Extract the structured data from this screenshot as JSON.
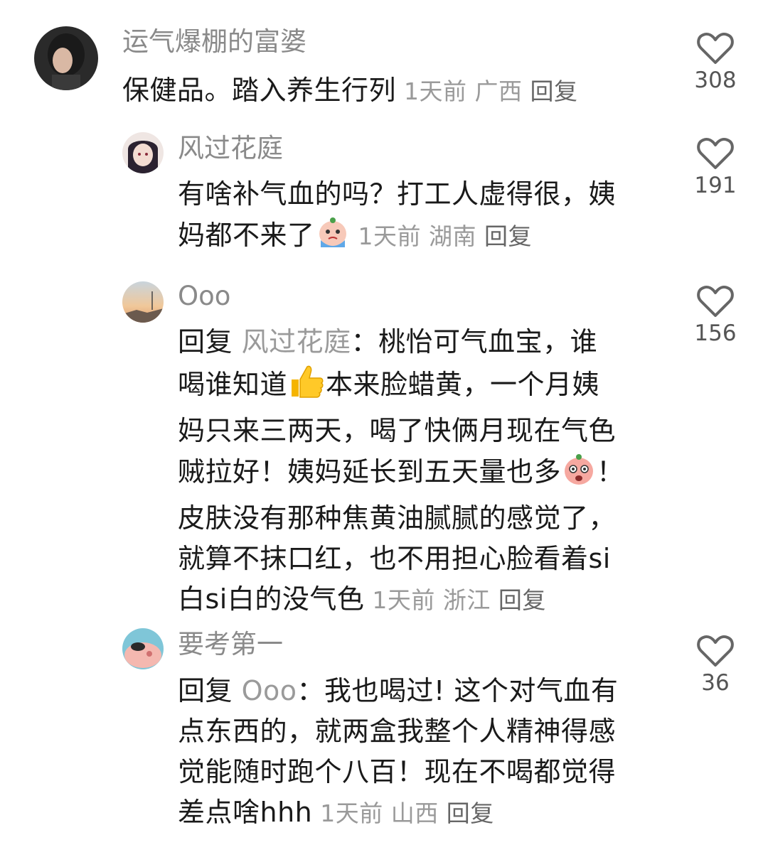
{
  "comments": [
    {
      "author": "运气爆棚的富婆",
      "text": "保健品。踏入养生行列",
      "time": "1天前",
      "location": "广西",
      "reply_label": "回复",
      "likes": "308"
    },
    {
      "author": "风过花庭",
      "text_line1": "有啥补气血的吗？打工人虚得很，姨",
      "text_line2": "妈都不来了",
      "time": "1天前",
      "location": "湖南",
      "reply_label": "回复",
      "likes": "191"
    },
    {
      "author": "Ooo",
      "reply_prefix": "回复",
      "reply_to": "风过花庭",
      "colon": "：",
      "line1": "桃怡可气血宝，谁",
      "line2a": "喝谁知道",
      "line2b": "本来脸蜡黄，一个月姨",
      "line3": "妈只来三两天，喝了快俩月现在气色",
      "line4a": "贼拉好！姨妈延长到五天量也多",
      "line4b": "！",
      "line5": "皮肤没有那种焦黄油腻腻的感觉了，",
      "line6": "就算不抹口红，也不用担心脸看着si",
      "line7": "白si白的没气色",
      "time": "1天前",
      "location": "浙江",
      "reply_label": "回复",
      "likes": "156"
    },
    {
      "author": "要考第一",
      "reply_prefix": "回复",
      "reply_to": "Ooo",
      "colon": "：",
      "line1": "我也喝过! 这个对气血有",
      "line2": "点东西的，就两盒我整个人精神得感",
      "line3": "觉能随时跑个八百！现在不喝都觉得",
      "line4": "差点啥hhh",
      "time": "1天前",
      "location": "山西",
      "reply_label": "回复",
      "likes": "36"
    }
  ],
  "icons": {
    "like": "heart-outline-icon",
    "emoji_cry": "crying-face-emoji",
    "emoji_thumb": "thumbs-up-emoji",
    "emoji_surprise": "surprised-face-emoji"
  },
  "colors": {
    "author": "#8a8a8a",
    "meta": "#9a9a9a",
    "text": "#1a1a1a"
  }
}
